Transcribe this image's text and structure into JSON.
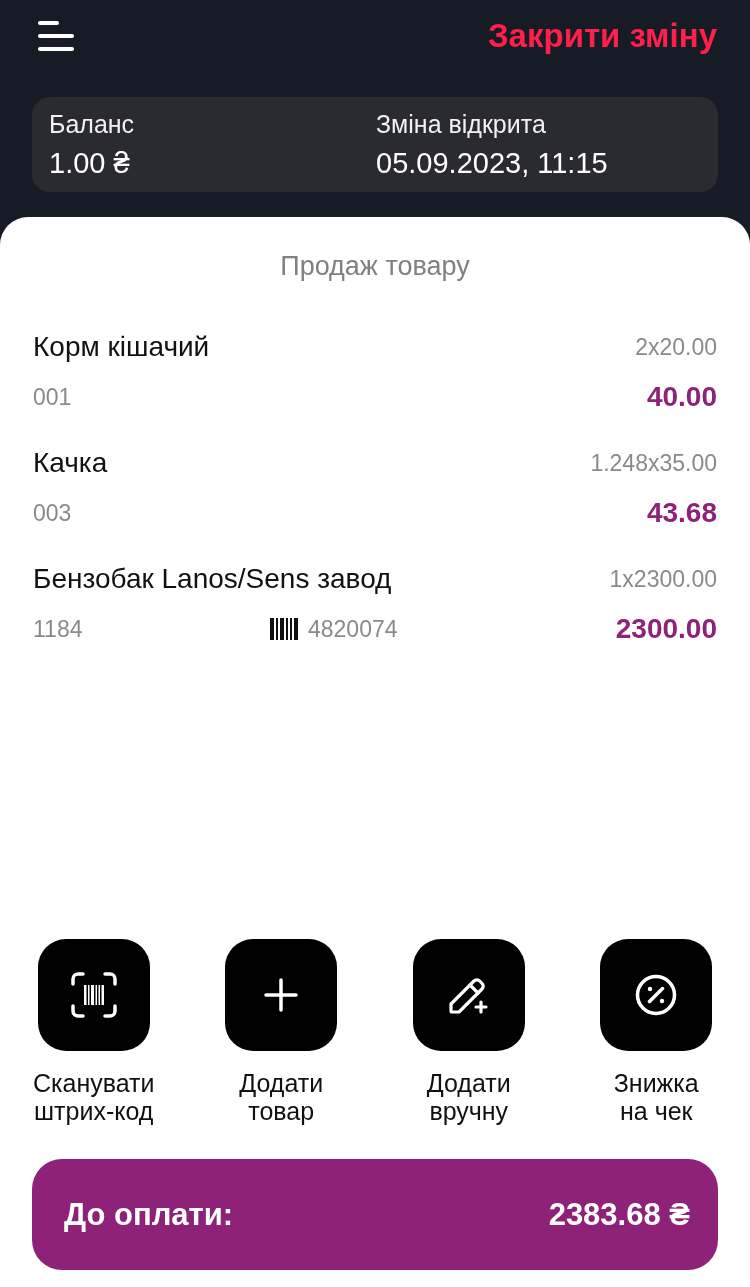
{
  "header": {
    "close_shift": "Закрити зміну"
  },
  "summary": {
    "balance_label": "Баланс",
    "balance": "1.00 ₴",
    "shift_label": "Зміна відкрита",
    "shift_opened": "05.09.2023, 11:15"
  },
  "sale": {
    "title": "Продаж товару",
    "items": [
      {
        "name": "Корм кішачий",
        "quantity_price": "2x20.00",
        "code": "001",
        "total": "40.00"
      },
      {
        "name": "Качка",
        "quantity_price": "1.248x35.00",
        "code": "003",
        "total": "43.68"
      },
      {
        "name": "Бензобак Lanos/Sens завод",
        "quantity_price": "1x2300.00",
        "code": "1184",
        "barcode": "4820074",
        "total": "2300.00"
      }
    ]
  },
  "actions": [
    {
      "kind": "scan",
      "label": "Сканувати\nштрих-код"
    },
    {
      "kind": "add",
      "label": "Додати\nтовар"
    },
    {
      "kind": "manual",
      "label": "Додати\nвручну"
    },
    {
      "kind": "discount",
      "label": "Знижка\nна чек"
    }
  ],
  "payment": {
    "label": "До оплати:",
    "amount": "2383.68 ₴"
  }
}
